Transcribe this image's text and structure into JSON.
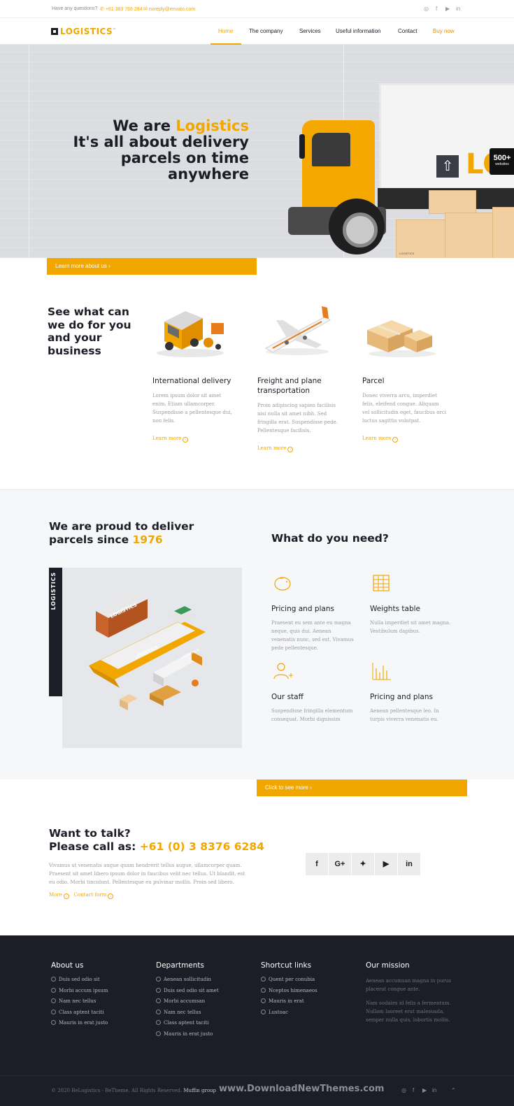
{
  "topbar": {
    "question": "Have any questions?",
    "phone": "+61 383 766 284",
    "email": "noreply@envato.com",
    "social_icons": [
      "skype-icon",
      "facebook-icon",
      "youtube-icon",
      "linkedin-icon"
    ]
  },
  "header": {
    "logo_text": "LOGISTICS",
    "logo_tm": "™",
    "nav": [
      "Home",
      "The company",
      "Services",
      "Useful information",
      "Contact",
      "Buy now"
    ],
    "active": "Home"
  },
  "hero": {
    "line1_a": "We are ",
    "line1_b": "Logistics",
    "line2": "It's all about delivery",
    "line3": "parcels on time",
    "line4": "anywhere",
    "cta": "Learn more about us",
    "badge_number": "500+",
    "badge_text": "websites",
    "truck_letters": "LO",
    "box_label": "LOGISTICS"
  },
  "services": {
    "title": "See what can we do for you and your business",
    "items": [
      {
        "title": "International delivery",
        "text": "Lorem ipsum dolor sit amet enim. Etiam ullamcorper. Suspendisse a pellentesque dui, non felis.",
        "link": "Learn more"
      },
      {
        "title": "Freight and plane transportation",
        "text": "Proin adipiscing sapien facilisis nisi nulla sit amet nibh. Sed fringilla erat. Suspendisse pede. Pellentesque facilisis.",
        "link": "Learn more"
      },
      {
        "title": "Parcel",
        "text": "Donec viverra arcu, imperdiet felis, eleifend congue. Aliquam vel sollicitudin eget, faucibus orci luctus sagittis volutpat.",
        "link": "Learn more"
      }
    ]
  },
  "proud": {
    "title_a": "We are proud to deliver",
    "title_b": "parcels since ",
    "year": "1976",
    "strip_text": "LOGISTICS",
    "illustration_labels": [
      "LOGISTICS",
      "LOGISTICS",
      "LOGISTICS"
    ]
  },
  "needs": {
    "title": "What do you need?",
    "items": [
      {
        "icon": "piggy-bank-icon",
        "title": "Pricing and plans",
        "text": "Praesent eu sem ante eu magna neque, quis dui. Aenean venenatis nunc, sed est. Vivamus pede pellentesque."
      },
      {
        "icon": "table-icon",
        "title": "Weights table",
        "text": "Nulla imperdiet sit amet magna. Vestibulum dapibus."
      },
      {
        "icon": "add-user-icon",
        "title": "Our staff",
        "text": "Suspendisse fringilla elementum consequat. Morbi dignissim"
      },
      {
        "icon": "bar-chart-icon",
        "title": "Pricing and plans",
        "text": "Aenean pellentesque leo. In turpis viverra venenatis eu."
      }
    ],
    "cta": "Click to see more"
  },
  "talk": {
    "line1": "Want to talk?",
    "line2": "Please call as: ",
    "phone": "+61 (0) 3 8376 6284",
    "text": "Vivamus ut venenatis augue quam hendrerit tellus augue, ullamcorper quam. Praesent sit amet libero ipsum dolor in faucibus velit nec tellus. Ut blandit, est eu odio. Morbi tincidunt. Pellentesque eu pulvinar mollis. Proin sed libero.",
    "more": "More",
    "contact": "Contact form",
    "social": [
      "f",
      "G+",
      "twitter-icon",
      "youtube-icon",
      "in"
    ]
  },
  "footer": {
    "about": {
      "title": "About us",
      "items": [
        "Duis sed odio sit",
        "Morbi accum ipsum",
        "Nam nec tellus",
        "Class aptent taciti",
        "Mauris in erat justo"
      ]
    },
    "departments": {
      "title": "Departments",
      "items": [
        "Aenean sollicitudin",
        "Duis sed odio sit amet",
        "Morbi accumsan",
        "Nam nec tellus",
        "Class aptent taciti",
        "Mauris in erat justo"
      ]
    },
    "shortcuts": {
      "title": "Shortcut links",
      "items": [
        "Quent per conubia",
        "Nceptos himenaeos",
        "Mauris in erat",
        "Lustoac"
      ]
    },
    "mission": {
      "title": "Our mission",
      "p1": "Aenean accumsan magna in purus placerat congue ante.",
      "p2": "Nam sodales id felis a fermentum. Nullam laoreet erat malesuada, semper nulla quis, lobortis mollis."
    },
    "copyright": "© 2020 BeLogistics - BeTheme. All Rights Reserved.",
    "copyright_brand": "Muffin group",
    "watermark": "www.DownloadNewThemes.com"
  },
  "colors": {
    "accent": "#f2a600",
    "dark": "#1c1d26"
  }
}
